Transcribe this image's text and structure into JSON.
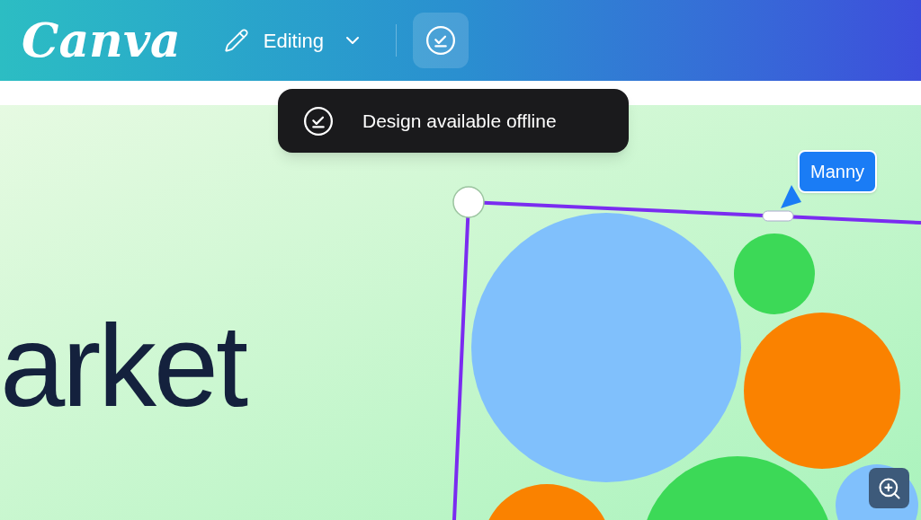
{
  "header": {
    "logo": "Canva",
    "mode": "Editing"
  },
  "toast": {
    "text": "Design available offline"
  },
  "canvas": {
    "heading": "arket",
    "collaborator": "Manny"
  }
}
